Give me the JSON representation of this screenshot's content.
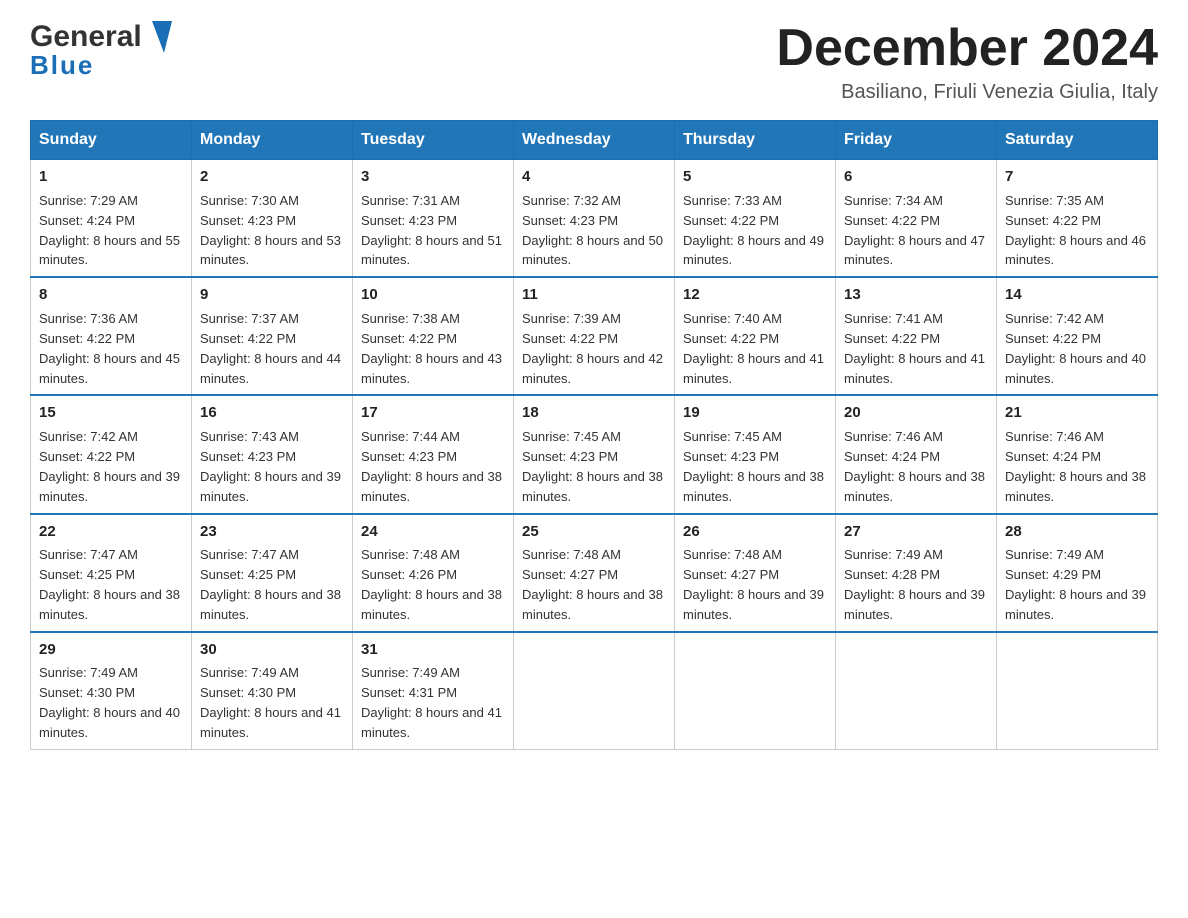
{
  "header": {
    "logo_general": "General",
    "logo_blue": "Blue",
    "title": "December 2024",
    "subtitle": "Basiliano, Friuli Venezia Giulia, Italy"
  },
  "days_of_week": [
    "Sunday",
    "Monday",
    "Tuesday",
    "Wednesday",
    "Thursday",
    "Friday",
    "Saturday"
  ],
  "weeks": [
    [
      {
        "day": "1",
        "sunrise": "7:29 AM",
        "sunset": "4:24 PM",
        "daylight": "8 hours and 55 minutes."
      },
      {
        "day": "2",
        "sunrise": "7:30 AM",
        "sunset": "4:23 PM",
        "daylight": "8 hours and 53 minutes."
      },
      {
        "day": "3",
        "sunrise": "7:31 AM",
        "sunset": "4:23 PM",
        "daylight": "8 hours and 51 minutes."
      },
      {
        "day": "4",
        "sunrise": "7:32 AM",
        "sunset": "4:23 PM",
        "daylight": "8 hours and 50 minutes."
      },
      {
        "day": "5",
        "sunrise": "7:33 AM",
        "sunset": "4:22 PM",
        "daylight": "8 hours and 49 minutes."
      },
      {
        "day": "6",
        "sunrise": "7:34 AM",
        "sunset": "4:22 PM",
        "daylight": "8 hours and 47 minutes."
      },
      {
        "day": "7",
        "sunrise": "7:35 AM",
        "sunset": "4:22 PM",
        "daylight": "8 hours and 46 minutes."
      }
    ],
    [
      {
        "day": "8",
        "sunrise": "7:36 AM",
        "sunset": "4:22 PM",
        "daylight": "8 hours and 45 minutes."
      },
      {
        "day": "9",
        "sunrise": "7:37 AM",
        "sunset": "4:22 PM",
        "daylight": "8 hours and 44 minutes."
      },
      {
        "day": "10",
        "sunrise": "7:38 AM",
        "sunset": "4:22 PM",
        "daylight": "8 hours and 43 minutes."
      },
      {
        "day": "11",
        "sunrise": "7:39 AM",
        "sunset": "4:22 PM",
        "daylight": "8 hours and 42 minutes."
      },
      {
        "day": "12",
        "sunrise": "7:40 AM",
        "sunset": "4:22 PM",
        "daylight": "8 hours and 41 minutes."
      },
      {
        "day": "13",
        "sunrise": "7:41 AM",
        "sunset": "4:22 PM",
        "daylight": "8 hours and 41 minutes."
      },
      {
        "day": "14",
        "sunrise": "7:42 AM",
        "sunset": "4:22 PM",
        "daylight": "8 hours and 40 minutes."
      }
    ],
    [
      {
        "day": "15",
        "sunrise": "7:42 AM",
        "sunset": "4:22 PM",
        "daylight": "8 hours and 39 minutes."
      },
      {
        "day": "16",
        "sunrise": "7:43 AM",
        "sunset": "4:23 PM",
        "daylight": "8 hours and 39 minutes."
      },
      {
        "day": "17",
        "sunrise": "7:44 AM",
        "sunset": "4:23 PM",
        "daylight": "8 hours and 38 minutes."
      },
      {
        "day": "18",
        "sunrise": "7:45 AM",
        "sunset": "4:23 PM",
        "daylight": "8 hours and 38 minutes."
      },
      {
        "day": "19",
        "sunrise": "7:45 AM",
        "sunset": "4:23 PM",
        "daylight": "8 hours and 38 minutes."
      },
      {
        "day": "20",
        "sunrise": "7:46 AM",
        "sunset": "4:24 PM",
        "daylight": "8 hours and 38 minutes."
      },
      {
        "day": "21",
        "sunrise": "7:46 AM",
        "sunset": "4:24 PM",
        "daylight": "8 hours and 38 minutes."
      }
    ],
    [
      {
        "day": "22",
        "sunrise": "7:47 AM",
        "sunset": "4:25 PM",
        "daylight": "8 hours and 38 minutes."
      },
      {
        "day": "23",
        "sunrise": "7:47 AM",
        "sunset": "4:25 PM",
        "daylight": "8 hours and 38 minutes."
      },
      {
        "day": "24",
        "sunrise": "7:48 AM",
        "sunset": "4:26 PM",
        "daylight": "8 hours and 38 minutes."
      },
      {
        "day": "25",
        "sunrise": "7:48 AM",
        "sunset": "4:27 PM",
        "daylight": "8 hours and 38 minutes."
      },
      {
        "day": "26",
        "sunrise": "7:48 AM",
        "sunset": "4:27 PM",
        "daylight": "8 hours and 39 minutes."
      },
      {
        "day": "27",
        "sunrise": "7:49 AM",
        "sunset": "4:28 PM",
        "daylight": "8 hours and 39 minutes."
      },
      {
        "day": "28",
        "sunrise": "7:49 AM",
        "sunset": "4:29 PM",
        "daylight": "8 hours and 39 minutes."
      }
    ],
    [
      {
        "day": "29",
        "sunrise": "7:49 AM",
        "sunset": "4:30 PM",
        "daylight": "8 hours and 40 minutes."
      },
      {
        "day": "30",
        "sunrise": "7:49 AM",
        "sunset": "4:30 PM",
        "daylight": "8 hours and 41 minutes."
      },
      {
        "day": "31",
        "sunrise": "7:49 AM",
        "sunset": "4:31 PM",
        "daylight": "8 hours and 41 minutes."
      },
      null,
      null,
      null,
      null
    ]
  ],
  "labels": {
    "sunrise": "Sunrise:",
    "sunset": "Sunset:",
    "daylight": "Daylight:"
  }
}
